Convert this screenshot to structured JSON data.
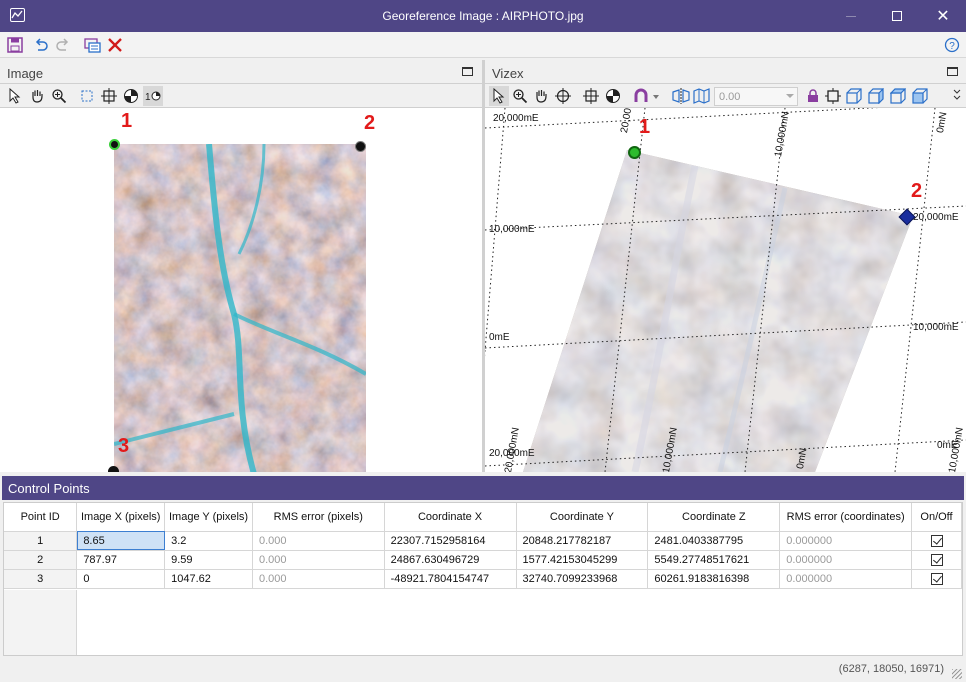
{
  "window": {
    "title": "Georeference Image : AIRPHOTO.jpg"
  },
  "left_panel": {
    "title": "Image",
    "markers": [
      "1",
      "2",
      "3"
    ]
  },
  "right_panel": {
    "title": "Vizex",
    "rotation_value": "0.00",
    "markers": [
      "1",
      "2"
    ],
    "grid_labels": [
      "20,000mE",
      "20,000mN",
      "10,000mN",
      "0mN",
      "10,000mE",
      "20,000mE",
      "0mE",
      "10,000mE",
      "10,000mN",
      "20,000mN",
      "0mN",
      "20,000mE",
      "0mE",
      "10,000mN"
    ]
  },
  "control_points": {
    "title": "Control Points",
    "columns": [
      "Point ID",
      "Image X (pixels)",
      "Image Y (pixels)",
      "RMS error (pixels)",
      "Coordinate X",
      "Coordinate Y",
      "Coordinate Z",
      "RMS error (coordinates)",
      "On/Off"
    ],
    "rows": [
      {
        "id": "1",
        "image_x": "8.65",
        "image_y": "3.2",
        "rms_px": "0.000",
        "coord_x": "22307.7152958164",
        "coord_y": "20848.217782187",
        "coord_z": "2481.0403387795",
        "rms_coord": "0.000000",
        "on": true
      },
      {
        "id": "2",
        "image_x": "787.97",
        "image_y": "9.59",
        "rms_px": "0.000",
        "coord_x": "24867.630496729",
        "coord_y": "1577.42153045299",
        "coord_z": "5549.27748517621",
        "rms_coord": "0.000000",
        "on": true
      },
      {
        "id": "3",
        "image_x": "0",
        "image_y": "1047.62",
        "rms_px": "0.000",
        "coord_x": "-48921.7804154747",
        "coord_y": "32740.7099233968",
        "coord_z": "60261.9183816398",
        "rms_coord": "0.000000",
        "on": true
      }
    ]
  },
  "status": {
    "coordinates": "(6287, 18050, 16971)"
  },
  "icons": [
    "save-icon",
    "undo-icon",
    "redo-icon",
    "georef-icon",
    "delete-icon",
    "help-icon",
    "select-icon",
    "pan-icon",
    "zoom-icon",
    "crop-icon",
    "target-icon",
    "contrast-icon",
    "one-to-one-icon"
  ],
  "colors": {
    "titlebar": "#4f4686",
    "marker": "#e21a1a"
  }
}
